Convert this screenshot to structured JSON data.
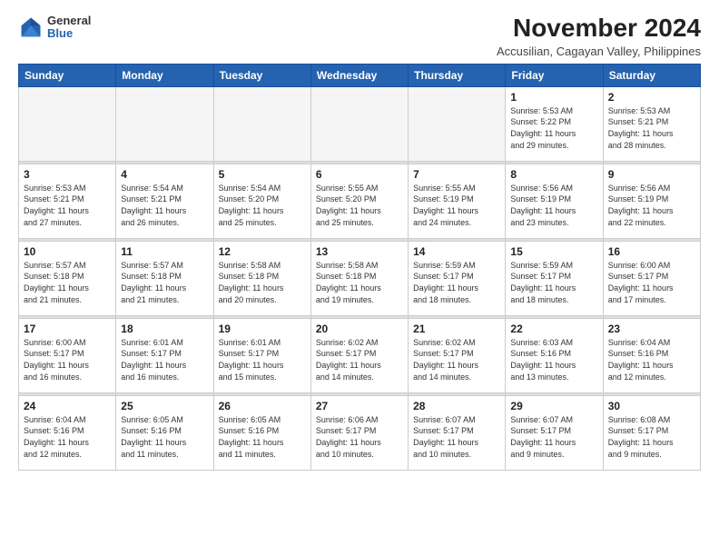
{
  "logo": {
    "general": "General",
    "blue": "Blue"
  },
  "header": {
    "month": "November 2024",
    "location": "Accusilian, Cagayan Valley, Philippines"
  },
  "days_of_week": [
    "Sunday",
    "Monday",
    "Tuesday",
    "Wednesday",
    "Thursday",
    "Friday",
    "Saturday"
  ],
  "weeks": [
    [
      {
        "day": "",
        "detail": ""
      },
      {
        "day": "",
        "detail": ""
      },
      {
        "day": "",
        "detail": ""
      },
      {
        "day": "",
        "detail": ""
      },
      {
        "day": "",
        "detail": ""
      },
      {
        "day": "1",
        "detail": "Sunrise: 5:53 AM\nSunset: 5:22 PM\nDaylight: 11 hours\nand 29 minutes."
      },
      {
        "day": "2",
        "detail": "Sunrise: 5:53 AM\nSunset: 5:21 PM\nDaylight: 11 hours\nand 28 minutes."
      }
    ],
    [
      {
        "day": "3",
        "detail": "Sunrise: 5:53 AM\nSunset: 5:21 PM\nDaylight: 11 hours\nand 27 minutes."
      },
      {
        "day": "4",
        "detail": "Sunrise: 5:54 AM\nSunset: 5:21 PM\nDaylight: 11 hours\nand 26 minutes."
      },
      {
        "day": "5",
        "detail": "Sunrise: 5:54 AM\nSunset: 5:20 PM\nDaylight: 11 hours\nand 25 minutes."
      },
      {
        "day": "6",
        "detail": "Sunrise: 5:55 AM\nSunset: 5:20 PM\nDaylight: 11 hours\nand 25 minutes."
      },
      {
        "day": "7",
        "detail": "Sunrise: 5:55 AM\nSunset: 5:19 PM\nDaylight: 11 hours\nand 24 minutes."
      },
      {
        "day": "8",
        "detail": "Sunrise: 5:56 AM\nSunset: 5:19 PM\nDaylight: 11 hours\nand 23 minutes."
      },
      {
        "day": "9",
        "detail": "Sunrise: 5:56 AM\nSunset: 5:19 PM\nDaylight: 11 hours\nand 22 minutes."
      }
    ],
    [
      {
        "day": "10",
        "detail": "Sunrise: 5:57 AM\nSunset: 5:18 PM\nDaylight: 11 hours\nand 21 minutes."
      },
      {
        "day": "11",
        "detail": "Sunrise: 5:57 AM\nSunset: 5:18 PM\nDaylight: 11 hours\nand 21 minutes."
      },
      {
        "day": "12",
        "detail": "Sunrise: 5:58 AM\nSunset: 5:18 PM\nDaylight: 11 hours\nand 20 minutes."
      },
      {
        "day": "13",
        "detail": "Sunrise: 5:58 AM\nSunset: 5:18 PM\nDaylight: 11 hours\nand 19 minutes."
      },
      {
        "day": "14",
        "detail": "Sunrise: 5:59 AM\nSunset: 5:17 PM\nDaylight: 11 hours\nand 18 minutes."
      },
      {
        "day": "15",
        "detail": "Sunrise: 5:59 AM\nSunset: 5:17 PM\nDaylight: 11 hours\nand 18 minutes."
      },
      {
        "day": "16",
        "detail": "Sunrise: 6:00 AM\nSunset: 5:17 PM\nDaylight: 11 hours\nand 17 minutes."
      }
    ],
    [
      {
        "day": "17",
        "detail": "Sunrise: 6:00 AM\nSunset: 5:17 PM\nDaylight: 11 hours\nand 16 minutes."
      },
      {
        "day": "18",
        "detail": "Sunrise: 6:01 AM\nSunset: 5:17 PM\nDaylight: 11 hours\nand 16 minutes."
      },
      {
        "day": "19",
        "detail": "Sunrise: 6:01 AM\nSunset: 5:17 PM\nDaylight: 11 hours\nand 15 minutes."
      },
      {
        "day": "20",
        "detail": "Sunrise: 6:02 AM\nSunset: 5:17 PM\nDaylight: 11 hours\nand 14 minutes."
      },
      {
        "day": "21",
        "detail": "Sunrise: 6:02 AM\nSunset: 5:17 PM\nDaylight: 11 hours\nand 14 minutes."
      },
      {
        "day": "22",
        "detail": "Sunrise: 6:03 AM\nSunset: 5:16 PM\nDaylight: 11 hours\nand 13 minutes."
      },
      {
        "day": "23",
        "detail": "Sunrise: 6:04 AM\nSunset: 5:16 PM\nDaylight: 11 hours\nand 12 minutes."
      }
    ],
    [
      {
        "day": "24",
        "detail": "Sunrise: 6:04 AM\nSunset: 5:16 PM\nDaylight: 11 hours\nand 12 minutes."
      },
      {
        "day": "25",
        "detail": "Sunrise: 6:05 AM\nSunset: 5:16 PM\nDaylight: 11 hours\nand 11 minutes."
      },
      {
        "day": "26",
        "detail": "Sunrise: 6:05 AM\nSunset: 5:16 PM\nDaylight: 11 hours\nand 11 minutes."
      },
      {
        "day": "27",
        "detail": "Sunrise: 6:06 AM\nSunset: 5:17 PM\nDaylight: 11 hours\nand 10 minutes."
      },
      {
        "day": "28",
        "detail": "Sunrise: 6:07 AM\nSunset: 5:17 PM\nDaylight: 11 hours\nand 10 minutes."
      },
      {
        "day": "29",
        "detail": "Sunrise: 6:07 AM\nSunset: 5:17 PM\nDaylight: 11 hours\nand 9 minutes."
      },
      {
        "day": "30",
        "detail": "Sunrise: 6:08 AM\nSunset: 5:17 PM\nDaylight: 11 hours\nand 9 minutes."
      }
    ]
  ]
}
